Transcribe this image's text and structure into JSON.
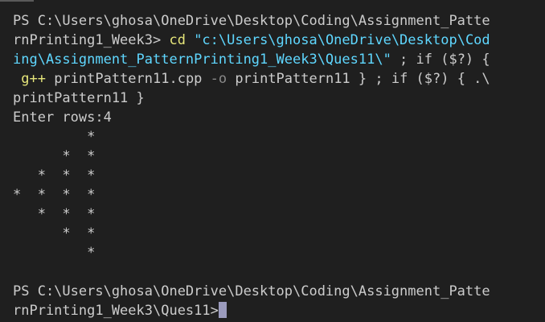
{
  "terminal": {
    "lines": [
      [
        {
          "text": "PS C:\\Users\\ghosa\\OneDrive\\Desktop\\Coding\\Assignment_Patte",
          "style": "default"
        }
      ],
      [
        {
          "text": "rnPrinting1_Week3> ",
          "style": "default"
        },
        {
          "text": "cd ",
          "style": "cmd"
        },
        {
          "text": "\"c:\\Users\\ghosa\\OneDrive\\Desktop\\Cod",
          "style": "string"
        }
      ],
      [
        {
          "text": "ing\\Assignment_PatternPrinting1_Week3\\Ques11\\\"",
          "style": "string"
        },
        {
          "text": " ; if ($?) {",
          "style": "default"
        }
      ],
      [
        {
          "text": " g++ ",
          "style": "cmd"
        },
        {
          "text": "printPattern11.cpp ",
          "style": "default"
        },
        {
          "text": "-o ",
          "style": "flag"
        },
        {
          "text": "printPattern11 } ; if ($?) { .\\",
          "style": "default"
        }
      ],
      [
        {
          "text": "printPattern11 }",
          "style": "default"
        }
      ],
      [
        {
          "text": "Enter rows:4",
          "style": "output"
        }
      ],
      [
        {
          "text": "         *",
          "style": "star"
        }
      ],
      [
        {
          "text": "      *  *",
          "style": "star"
        }
      ],
      [
        {
          "text": "   *  *  *",
          "style": "star"
        }
      ],
      [
        {
          "text": "*  *  *  *",
          "style": "star"
        }
      ],
      [
        {
          "text": "   *  *  *",
          "style": "star"
        }
      ],
      [
        {
          "text": "      *  *",
          "style": "star"
        }
      ],
      [
        {
          "text": "         *",
          "style": "star"
        }
      ],
      [
        {
          "text": "",
          "style": "default"
        }
      ],
      [
        {
          "text": "PS C:\\Users\\ghosa\\OneDrive\\Desktop\\Coding\\Assignment_Patte",
          "style": "default"
        }
      ],
      [
        {
          "text": "rnPrinting1_Week3\\Ques11>",
          "style": "default"
        }
      ]
    ],
    "colors": {
      "background": "#1f1f1f",
      "default": "#cccccc",
      "cmd": "#e5e57a",
      "string": "#5fd7ff",
      "flag": "#8a8a8a",
      "cursor": "#9b9bbd"
    }
  }
}
